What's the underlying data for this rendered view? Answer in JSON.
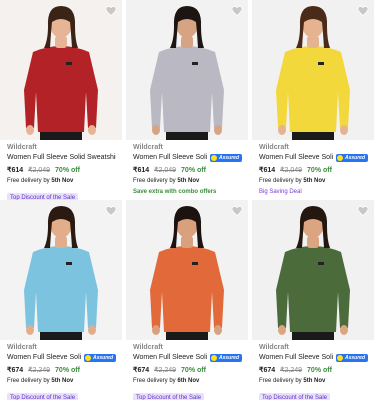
{
  "products": [
    {
      "brand": "Wildcraft",
      "title": "Women Full Sleeve Solid Sweatshirt",
      "assured": false,
      "price": "₹614",
      "mrp": "₹2,049",
      "off": "70% off",
      "delivery_prefix": "Free delivery by",
      "delivery_date": "5th Nov",
      "offer": "Top Discount of the Sale",
      "offer_style": "badge",
      "color": "#b32226",
      "bg": "#f4f1ef",
      "skin": "#e7b595",
      "hair": "#3a2416"
    },
    {
      "brand": "Wildcraft",
      "title": "Women Full Sleeve Solid ...",
      "assured": true,
      "price": "₹614",
      "mrp": "₹2,049",
      "off": "70% off",
      "delivery_prefix": "Free delivery by",
      "delivery_date": "5th Nov",
      "offer": "Save extra with combo offers",
      "offer_style": "green",
      "color": "#b9b8c3",
      "bg": "#f2f2f2",
      "skin": "#d6a483",
      "hair": "#1d1512"
    },
    {
      "brand": "Wildcraft",
      "title": "Women Full Sleeve Solid ...",
      "assured": true,
      "price": "₹614",
      "mrp": "₹2,049",
      "off": "70% off",
      "delivery_prefix": "Free delivery by",
      "delivery_date": "5th Nov",
      "offer": "Big Saving Deal",
      "offer_style": "purple",
      "color": "#f2d83b",
      "bg": "#f1f1f1",
      "skin": "#e5b390",
      "hair": "#4a2a18"
    },
    {
      "brand": "Wildcraft",
      "title": "Women Full Sleeve Solid ...",
      "assured": true,
      "price": "₹674",
      "mrp": "₹2,249",
      "off": "70% off",
      "delivery_prefix": "Free delivery by",
      "delivery_date": "5th Nov",
      "offer": "Top Discount of the Sale",
      "offer_style": "badge",
      "color": "#7cc3e0",
      "bg": "#f3f3f3",
      "skin": "#e2ad8a",
      "hair": "#2a1a12"
    },
    {
      "brand": "Wildcraft",
      "title": "Women Full Sleeve Solid ...",
      "assured": true,
      "price": "₹674",
      "mrp": "₹2,249",
      "off": "70% off",
      "delivery_prefix": "Free delivery by",
      "delivery_date": "6th Nov",
      "offer": "Top Discount of the Sale",
      "offer_style": "badge",
      "color": "#e2693a",
      "bg": "#f2f2f2",
      "skin": "#d8a07c",
      "hair": "#1c1310"
    },
    {
      "brand": "Wildcraft",
      "title": "Women Full Sleeve Solid ...",
      "assured": true,
      "price": "₹674",
      "mrp": "₹2,249",
      "off": "70% off",
      "delivery_prefix": "Free delivery by",
      "delivery_date": "5th Nov",
      "offer": "Top Discount of the Sale",
      "offer_style": "badge",
      "color": "#4c6b3a",
      "bg": "#f1f1f1",
      "skin": "#dba582",
      "hair": "#24170f"
    }
  ],
  "assured_label": "Assured"
}
